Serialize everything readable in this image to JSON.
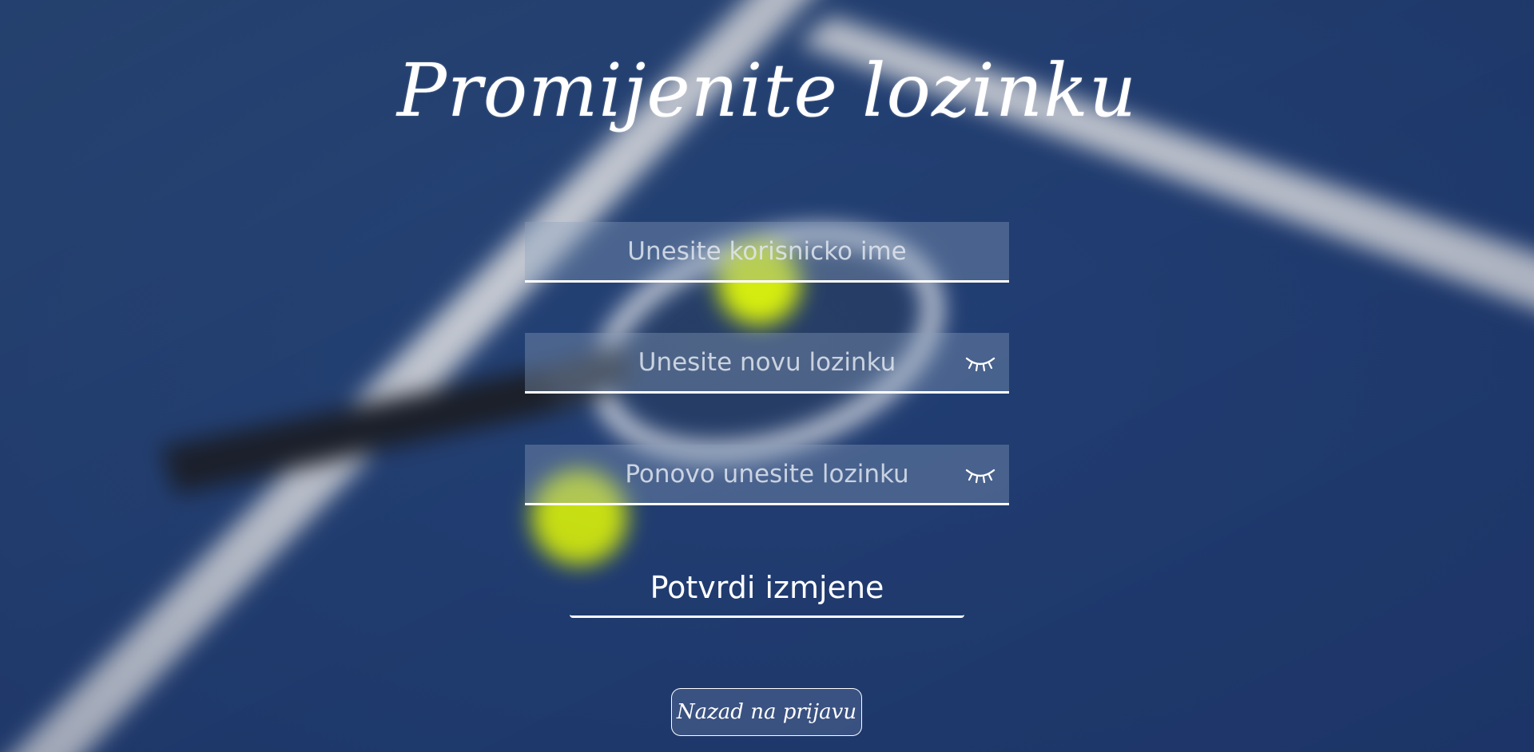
{
  "page": {
    "title": "Promijenite lozinku"
  },
  "form": {
    "username_placeholder": "Unesite korisnicko ime",
    "new_password_placeholder": "Unesite novu lozinku",
    "repeat_password_placeholder": "Ponovo unesite lozinku",
    "password_toggle_icon": "eye-closed-icon",
    "confirm_label": "Potvrdi izmjene"
  },
  "footer": {
    "back_label": "Nazad na prijavu"
  },
  "colors": {
    "court_blue": "#243d6a",
    "line_white": "#ffffff",
    "ball_yellow": "#d8f00e"
  }
}
